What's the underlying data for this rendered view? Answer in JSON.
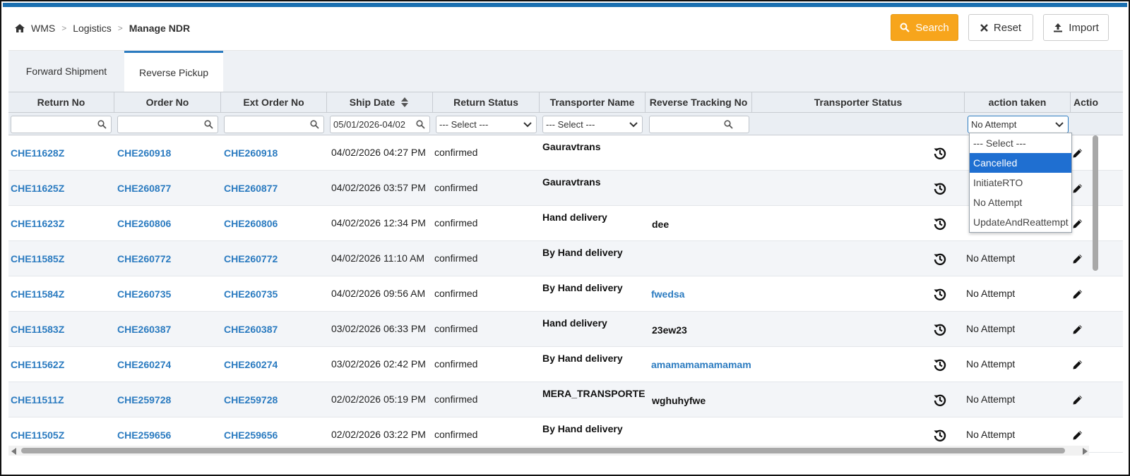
{
  "breadcrumb": {
    "home": "WMS",
    "section": "Logistics",
    "current": "Manage NDR"
  },
  "toolbar": {
    "search_label": "Search",
    "reset_label": "Reset",
    "import_label": "Import"
  },
  "tabs": [
    {
      "label": "Forward Shipment"
    },
    {
      "label": "Reverse Pickup"
    }
  ],
  "columns": [
    "Return No",
    "Order No",
    "Ext Order No",
    "Ship Date",
    "Return Status",
    "Transporter Name",
    "Reverse Tracking No",
    "Transporter Status",
    "action taken",
    "Actio"
  ],
  "filters": {
    "ship_date": "05/01/2026-04/02",
    "return_status": "--- Select ---",
    "transporter_name": "--- Select ---",
    "action_taken": "No Attempt"
  },
  "dropdown_options": [
    "--- Select ---",
    "Cancelled",
    "InitiateRTO",
    "No Attempt",
    "UpdateAndReattempt"
  ],
  "dropdown_selected": "Cancelled",
  "rows": [
    {
      "return_no": "CHE11628Z",
      "order_no": "CHE260918",
      "ext_order_no": "CHE260918",
      "ship_date": "04/02/2026 04:27 PM",
      "return_status": "confirmed",
      "transporter": "Gauravtrans",
      "tracking": "",
      "action": ""
    },
    {
      "return_no": "CHE11625Z",
      "order_no": "CHE260877",
      "ext_order_no": "CHE260877",
      "ship_date": "04/02/2026 03:57 PM",
      "return_status": "confirmed",
      "transporter": "Gauravtrans",
      "tracking": "",
      "action": ""
    },
    {
      "return_no": "CHE11623Z",
      "order_no": "CHE260806",
      "ext_order_no": "CHE260806",
      "ship_date": "04/02/2026 12:34 PM",
      "return_status": "confirmed",
      "transporter": "Hand delivery",
      "tracking": "dee",
      "action": ""
    },
    {
      "return_no": "CHE11585Z",
      "order_no": "CHE260772",
      "ext_order_no": "CHE260772",
      "ship_date": "04/02/2026 11:10 AM",
      "return_status": "confirmed",
      "transporter": "By Hand delivery",
      "tracking": "",
      "action": "No Attempt"
    },
    {
      "return_no": "CHE11584Z",
      "order_no": "CHE260735",
      "ext_order_no": "CHE260735",
      "ship_date": "04/02/2026 09:56 AM",
      "return_status": "confirmed",
      "transporter": "By Hand delivery",
      "tracking": "fwedsa",
      "action": "No Attempt"
    },
    {
      "return_no": "CHE11583Z",
      "order_no": "CHE260387",
      "ext_order_no": "CHE260387",
      "ship_date": "03/02/2026 06:33 PM",
      "return_status": "confirmed",
      "transporter": "Hand delivery",
      "tracking": "23ew23",
      "action": "No Attempt"
    },
    {
      "return_no": "CHE11562Z",
      "order_no": "CHE260274",
      "ext_order_no": "CHE260274",
      "ship_date": "03/02/2026 02:42 PM",
      "return_status": "confirmed",
      "transporter": "By Hand delivery",
      "tracking": "amamamamamamam",
      "action": "No Attempt"
    },
    {
      "return_no": "CHE11511Z",
      "order_no": "CHE259728",
      "ext_order_no": "CHE259728",
      "ship_date": "02/02/2026 05:19 PM",
      "return_status": "confirmed",
      "transporter": "MERA_TRANSPORTE",
      "tracking": "wghuhyfwe",
      "action": "No Attempt"
    },
    {
      "return_no": "CHE11505Z",
      "order_no": "CHE259656",
      "ext_order_no": "CHE259656",
      "ship_date": "02/02/2026 03:22 PM",
      "return_status": "confirmed",
      "transporter": "By Hand delivery",
      "tracking": "",
      "action": "No Attempt"
    }
  ],
  "tracking_link_rows": [
    4,
    6
  ],
  "icons": {
    "home": "home-icon",
    "search": "search-icon",
    "reset": "close-icon",
    "import": "upload-icon",
    "history": "history-icon",
    "edit": "pencil-icon"
  },
  "colors": {
    "accent": "#f7a51c",
    "link": "#2b7bc0",
    "tab_active": "#2b7bc0",
    "dropdown_selected": "#1f6fd1"
  }
}
